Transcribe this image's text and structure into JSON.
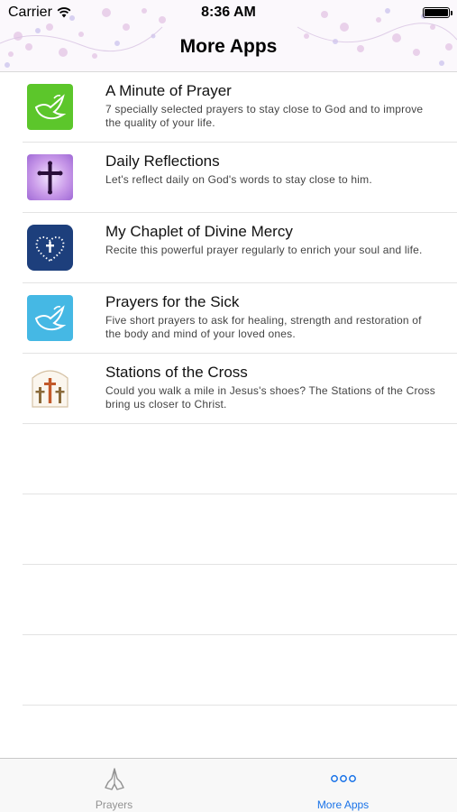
{
  "status_bar": {
    "carrier": "Carrier",
    "time": "8:36 AM"
  },
  "nav": {
    "title": "More Apps"
  },
  "apps": [
    {
      "title": "A Minute of Prayer",
      "description": "7 specially selected prayers to stay close to God and to improve the quality of your life.",
      "icon": "dove-icon",
      "icon_color": "#5cc62b"
    },
    {
      "title": "Daily Reflections",
      "description": "Let's reflect daily on God's words to stay close to him.",
      "icon": "cross-icon",
      "icon_color": "#b07be0"
    },
    {
      "title": "My Chaplet of Divine Mercy",
      "description": "Recite this powerful prayer regularly to enrich your soul and life.",
      "icon": "rosary-heart-icon",
      "icon_color": "#1d3f7c"
    },
    {
      "title": "Prayers for the Sick",
      "description": "Five short prayers to ask for healing, strength and restoration of the body and mind of your loved ones.",
      "icon": "dove-icon",
      "icon_color": "#45b8e4"
    },
    {
      "title": "Stations of the Cross",
      "description": "Could you walk a mile in Jesus's shoes? The Stations of the Cross bring us closer to Christ.",
      "icon": "three-crosses-icon",
      "icon_color": "#fbf6ee"
    }
  ],
  "tabbar": {
    "tabs": [
      {
        "label": "Prayers",
        "icon": "praying-hands-icon",
        "active": false
      },
      {
        "label": "More Apps",
        "icon": "more-dots-icon",
        "active": true
      }
    ]
  },
  "colors": {
    "accent": "#1a73e8",
    "inactive": "#929292"
  }
}
